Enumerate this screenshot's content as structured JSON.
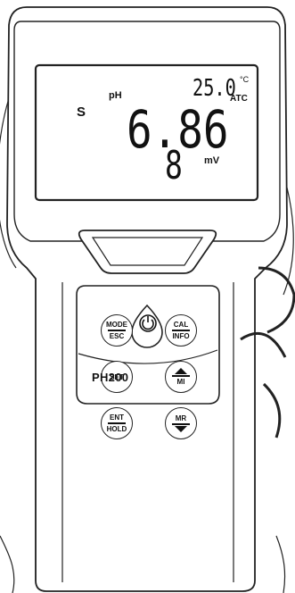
{
  "display": {
    "indicator": "S",
    "mode_label": "pH",
    "temperature": "25.0",
    "temp_unit": "°C",
    "temp_mode": "ATC",
    "main_reading": "6.86",
    "sub_reading": "8",
    "sub_unit": "mV"
  },
  "buttons": {
    "mode": {
      "line1": "MODE",
      "line2": "ESC"
    },
    "cal": {
      "line1": "CAL",
      "line2": "INFO"
    },
    "set": {
      "label": "SET"
    },
    "up_mi": {
      "label": "MI"
    },
    "ent": {
      "line1": "ENT",
      "line2": "HOLD"
    },
    "mr_down": {
      "label": "MR"
    }
  },
  "model": "PH200"
}
